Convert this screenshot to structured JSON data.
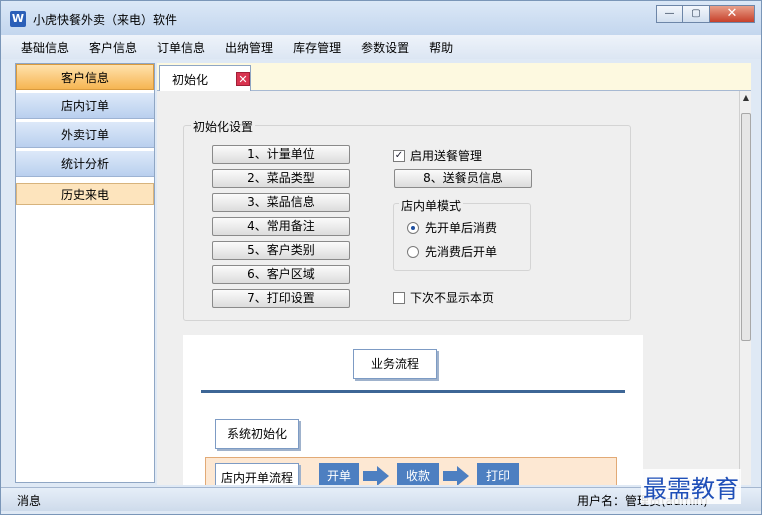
{
  "window": {
    "title": "小虎快餐外卖（来电）软件",
    "app_icon": "W",
    "controls": {
      "minimize": "—",
      "maximize": "▢",
      "close": "✕"
    }
  },
  "menu": [
    "基础信息",
    "客户信息",
    "订单信息",
    "出纳管理",
    "库存管理",
    "参数设置",
    "帮助"
  ],
  "sidebar": {
    "items": [
      "客户信息",
      "店内订单",
      "外卖订单",
      "统计分析"
    ],
    "history": "历史来电"
  },
  "tab": {
    "label": "初始化",
    "close": "✕"
  },
  "init": {
    "group_title": "初始化设置",
    "buttons": [
      "1、计量单位",
      "2、菜品类型",
      "3、菜品信息",
      "4、常用备注",
      "5、客户类别",
      "6、客户区域",
      "7、打印设置"
    ],
    "enable_delivery": "启用送餐管理",
    "delivery_button": "8、送餐员信息",
    "mode_title": "店内单模式",
    "mode_options": [
      "先开单后消费",
      "先消费后开单"
    ],
    "dont_show": "下次不显示本页"
  },
  "flow": {
    "title": "业务流程",
    "init_step": "系统初始化",
    "store_flow": "店内开单流程",
    "steps": [
      "开单",
      "收款",
      "打印"
    ]
  },
  "status": {
    "left": "消息",
    "right": "用户名：管理员(admin)"
  },
  "watermark": "最需教育"
}
